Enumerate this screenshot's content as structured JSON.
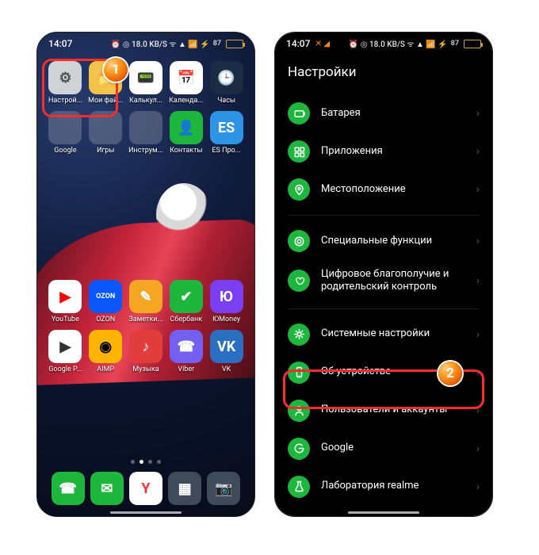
{
  "left": {
    "time": "14:07",
    "status_extra": "⏰ ◎ 18.0 KB/S ᯤ ▲ 📶 ⚡",
    "battery_pct": "87",
    "row1": [
      {
        "label": "Настрой...",
        "icon": "gear",
        "bg": "#cfd3d6",
        "fg": "#555"
      },
      {
        "label": "Мои фай...",
        "icon": "folder",
        "bg": "#f4c34a"
      },
      {
        "label": "Калькул...",
        "icon": "calc",
        "bg": "#ffffff",
        "fg": "#1eb73e"
      },
      {
        "label": "Календа...",
        "icon": "cal",
        "bg": "#ffffff",
        "fg": "#333"
      },
      {
        "label": "Часы",
        "icon": "clock",
        "bg": "#1d2a44",
        "fg": "#f7d25b"
      }
    ],
    "row2": [
      {
        "label": "Google",
        "icon": "folder-multi"
      },
      {
        "label": "Игры",
        "icon": "folder-multi"
      },
      {
        "label": "Инструм...",
        "icon": "folder-multi"
      },
      {
        "label": "Контакты",
        "icon": "contacts",
        "bg": "#1eb73e",
        "fg": "#fff"
      },
      {
        "label": "ES Про...",
        "icon": "es",
        "bg": "#2e94e6",
        "fg": "#fff"
      }
    ],
    "row3": [
      {
        "label": "YouTube",
        "icon": "yt",
        "bg": "#ffffff",
        "fg": "#ff0000"
      },
      {
        "label": "OZON",
        "icon": "ozon",
        "bg": "#0a57ff",
        "fg": "#fff"
      },
      {
        "label": "Заметки...",
        "icon": "note",
        "bg": "#f5a623",
        "fg": "#fff"
      },
      {
        "label": "Сбербанк",
        "icon": "sber",
        "bg": "#1eb73e",
        "fg": "#fff"
      },
      {
        "label": "ЮMoney",
        "icon": "yoo",
        "bg": "#7b3ff2",
        "fg": "#fff"
      }
    ],
    "row4": [
      {
        "label": "Google P...",
        "icon": "play",
        "bg": "#ffffff"
      },
      {
        "label": "AIMP",
        "icon": "aimp",
        "bg": "#ffb400",
        "fg": "#000"
      },
      {
        "label": "Музыка",
        "icon": "music",
        "bg": "#e23d3d",
        "fg": "#fff"
      },
      {
        "label": "Viber",
        "icon": "viber",
        "bg": "#7360f2",
        "fg": "#fff"
      },
      {
        "label": "VK",
        "icon": "vk",
        "bg": "#2a6fc2",
        "fg": "#fff"
      }
    ],
    "dock": [
      {
        "label": "Phone",
        "icon": "phone",
        "bg": "#1eb73e",
        "fg": "#fff"
      },
      {
        "label": "Messages",
        "icon": "msg",
        "bg": "#1eb73e",
        "fg": "#fff"
      },
      {
        "label": "Yandex",
        "icon": "yand",
        "bg": "#ffffff",
        "fg": "#ff3333"
      },
      {
        "label": "Apps",
        "icon": "apps",
        "bg": "#3f4a5a",
        "fg": "#fff"
      },
      {
        "label": "Camera",
        "icon": "cam",
        "bg": "#3f4a5a",
        "fg": "#fff"
      }
    ]
  },
  "right": {
    "time": "14:07",
    "status_extra": "⏰ ◎ 18.0 KB/S ᯤ ▲ 📶 ⚡",
    "battery_pct": "87",
    "title": "Настройки",
    "group1": [
      {
        "icon": "battery-icon",
        "label": "Батарея"
      },
      {
        "icon": "apps-icon",
        "label": "Приложения"
      },
      {
        "icon": "location-icon",
        "label": "Местоположение"
      }
    ],
    "group2": [
      {
        "icon": "special-icon",
        "label": "Специальные функции"
      },
      {
        "icon": "wellbeing-icon",
        "label": "Цифровое благополучие и родительский контроль"
      }
    ],
    "group3": [
      {
        "icon": "system-icon",
        "label": "Системные настройки"
      },
      {
        "icon": "about-icon",
        "label": "Об устройстве"
      },
      {
        "icon": "users-icon",
        "label": "Пользователи и аккаунты"
      },
      {
        "icon": "google-icon",
        "label": "Google"
      },
      {
        "icon": "lab-icon",
        "label": "Лаборатория realme"
      }
    ]
  },
  "callouts": {
    "one": "1",
    "two": "2"
  }
}
